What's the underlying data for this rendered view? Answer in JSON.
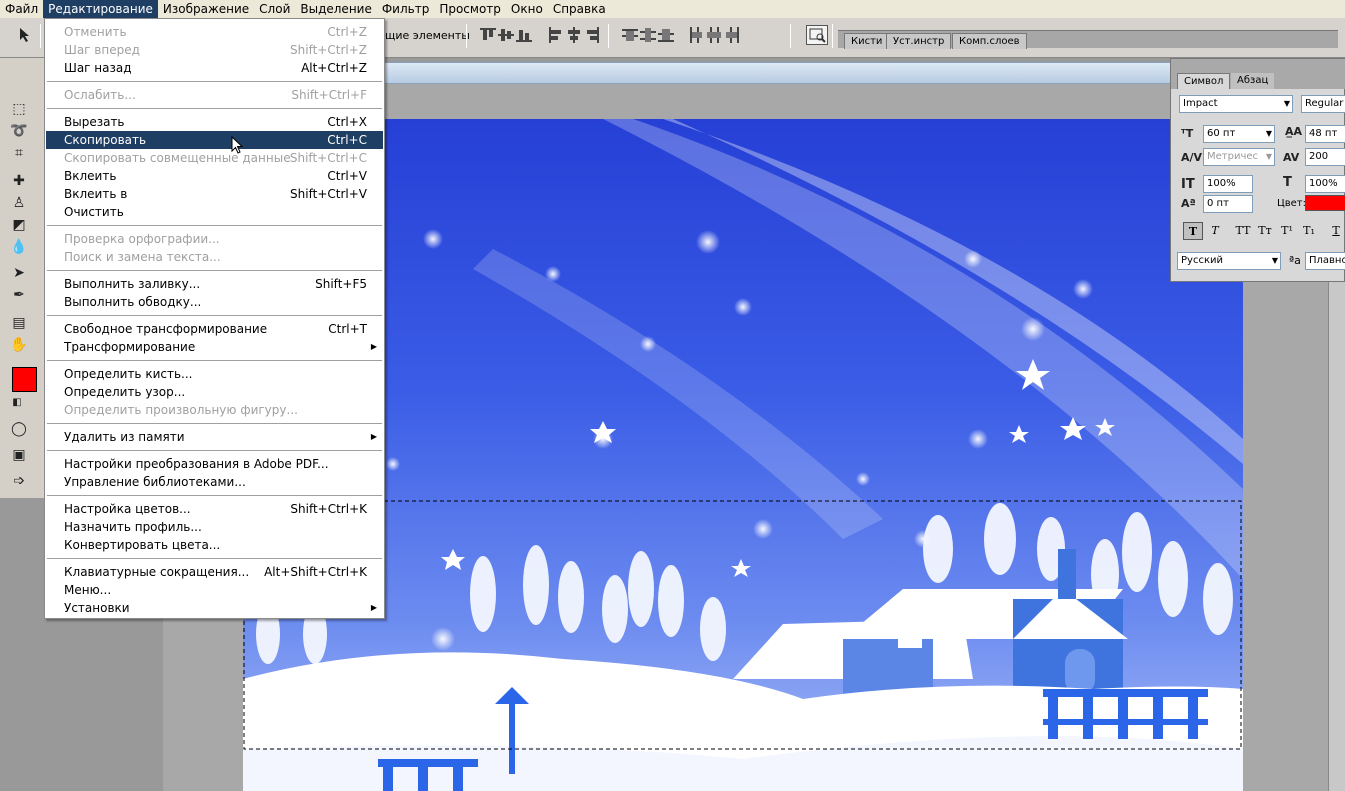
{
  "menubar": {
    "items": [
      "Файл",
      "Редактирование",
      "Изображение",
      "Слой",
      "Выделение",
      "Фильтр",
      "Просмотр",
      "Окно",
      "Справка"
    ],
    "active_index": 1
  },
  "options_bar": {
    "show_controls_partial": "щие элементы"
  },
  "palette_well": {
    "tabs": [
      "Кисти",
      "Уст.инстр",
      "Комп.слоев"
    ]
  },
  "colors": {
    "foreground": "#ff0000",
    "menu_highlight": "#1f3e63",
    "text_color_swatch": "#ff0000"
  },
  "edit_menu": {
    "items": [
      {
        "label": "Отменить",
        "shortcut": "Ctrl+Z",
        "disabled": true
      },
      {
        "label": "Шаг вперед",
        "shortcut": "Shift+Ctrl+Z",
        "disabled": true
      },
      {
        "label": "Шаг назад",
        "shortcut": "Alt+Ctrl+Z",
        "disabled": false
      },
      {
        "label": "Ослабить...",
        "shortcut": "Shift+Ctrl+F",
        "disabled": true
      },
      {
        "label": "Вырезать",
        "shortcut": "Ctrl+X",
        "disabled": false
      },
      {
        "label": "Скопировать",
        "shortcut": "Ctrl+C",
        "disabled": false,
        "highlighted": true
      },
      {
        "label": "Скопировать совмещенные данные",
        "shortcut": "Shift+Ctrl+C",
        "disabled": true
      },
      {
        "label": "Вклеить",
        "shortcut": "Ctrl+V",
        "disabled": false
      },
      {
        "label": "Вклеить в",
        "shortcut": "Shift+Ctrl+V",
        "disabled": false
      },
      {
        "label": "Очистить",
        "shortcut": "",
        "disabled": false
      },
      {
        "label": "Проверка орфографии...",
        "shortcut": "",
        "disabled": true
      },
      {
        "label": "Поиск и замена текста...",
        "shortcut": "",
        "disabled": true
      },
      {
        "label": "Выполнить заливку...",
        "shortcut": "Shift+F5",
        "disabled": false
      },
      {
        "label": "Выполнить обводку...",
        "shortcut": "",
        "disabled": false
      },
      {
        "label": "Свободное трансформирование",
        "shortcut": "Ctrl+T",
        "disabled": false
      },
      {
        "label": "Трансформирование",
        "shortcut": "",
        "disabled": false,
        "submenu": true
      },
      {
        "label": "Определить кисть...",
        "shortcut": "",
        "disabled": false
      },
      {
        "label": "Определить узор...",
        "shortcut": "",
        "disabled": false
      },
      {
        "label": "Определить произвольную фигуру...",
        "shortcut": "",
        "disabled": true
      },
      {
        "label": "Удалить из памяти",
        "shortcut": "",
        "disabled": false,
        "submenu": true
      },
      {
        "label": "Настройки преобразования в Adobe PDF...",
        "shortcut": "",
        "disabled": false
      },
      {
        "label": "Управление библиотеками...",
        "shortcut": "",
        "disabled": false
      },
      {
        "label": "Настройка цветов...",
        "shortcut": "Shift+Ctrl+K",
        "disabled": false
      },
      {
        "label": "Назначить профиль...",
        "shortcut": "",
        "disabled": false
      },
      {
        "label": "Конвертировать цвета...",
        "shortcut": "",
        "disabled": false
      },
      {
        "label": "Клавиатурные сокращения...",
        "shortcut": "Alt+Shift+Ctrl+K",
        "disabled": false
      },
      {
        "label": "Меню...",
        "shortcut": "",
        "disabled": false
      },
      {
        "label": "Установки",
        "shortcut": "",
        "disabled": false,
        "submenu": true
      }
    ],
    "submenu_arrow": "▶"
  },
  "character_panel": {
    "tabs": [
      "Символ",
      "Абзац"
    ],
    "font_family": "Impact",
    "font_style": "Regular",
    "font_size": "60 пт",
    "leading": "48 пт",
    "kerning": "Метричес",
    "tracking": "200",
    "vertical_scale": "100%",
    "horizontal_scale": "100%",
    "baseline_shift": "0 пт",
    "color_label": "Цвет:",
    "language": "Русский",
    "antialias_symbol": "ªa",
    "antialias": "Плавно",
    "style_buttons": [
      "T",
      "T",
      "TT",
      "Tт",
      "T¹",
      "T₁",
      "T"
    ]
  }
}
